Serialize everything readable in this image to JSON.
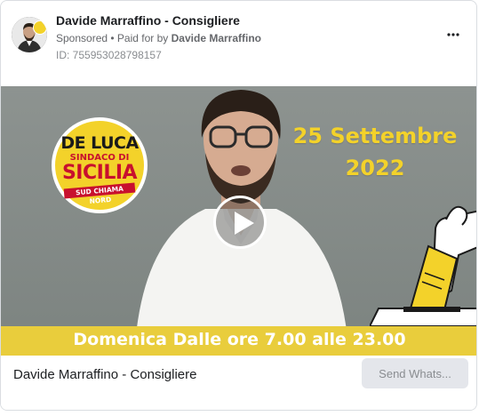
{
  "header": {
    "page_name": "Davide Marraffino - Consigliere",
    "sponsored_label": "Sponsored",
    "separator": " • ",
    "paid_for_by_label": "Paid for by",
    "payer_name": "Davide Marraffino",
    "ad_id": "ID: 755953028798157"
  },
  "media": {
    "logo": {
      "line1": "DE LUCA",
      "line2": "SINDACO DI",
      "line3": "SICILIA",
      "slogan": "SUD CHIAMA NORD"
    },
    "date_line1": "25 Settembre",
    "date_line2": "2022",
    "banner": "Domenica Dalle ore 7.00 alle 23.00",
    "accent_color": "#f3d22a"
  },
  "footer": {
    "title": "Davide Marraffino - Consigliere",
    "cta_label": "Send Whats..."
  }
}
